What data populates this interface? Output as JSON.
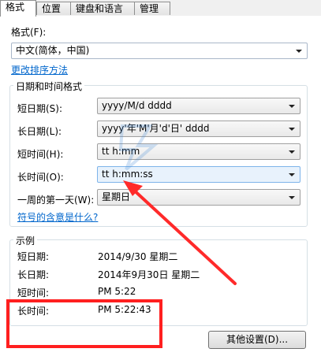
{
  "tabs": [
    "格式",
    "位置",
    "键盘和语言",
    "管理"
  ],
  "format": {
    "label": "格式(F):",
    "value": "中文(简体，中国)",
    "change_sort_link": "更改排序方法"
  },
  "datetime_group": {
    "title": "日期和时间格式",
    "short_date": {
      "label": "短日期(S):",
      "value": "yyyy/M/d dddd"
    },
    "long_date": {
      "label": "长日期(L):",
      "value": "yyyy'年'M'月'd'日' dddd"
    },
    "short_time": {
      "label": "短时间(H):",
      "value": "tt h:mm"
    },
    "long_time": {
      "label": "长时间(O):",
      "value": "tt h:mm:ss"
    },
    "first_day": {
      "label": "一周的第一天(W):",
      "value": "星期日"
    },
    "symbols_link": "符号的含意是什么?"
  },
  "example_group": {
    "title": "示例",
    "rows": [
      {
        "label": "短日期:",
        "value": "2014/9/30 星期二"
      },
      {
        "label": "长日期:",
        "value": "2014年9月30日 星期二"
      },
      {
        "label": "短时间:",
        "value": "PM 5:22"
      },
      {
        "label": "长时间:",
        "value": "PM 5:22:43"
      }
    ]
  },
  "other_settings_button": "其他设置(D)...",
  "colors": {
    "link": "#0066cc",
    "highlight_box": "#ff1f1f",
    "arrow": "#ff2a2a"
  }
}
